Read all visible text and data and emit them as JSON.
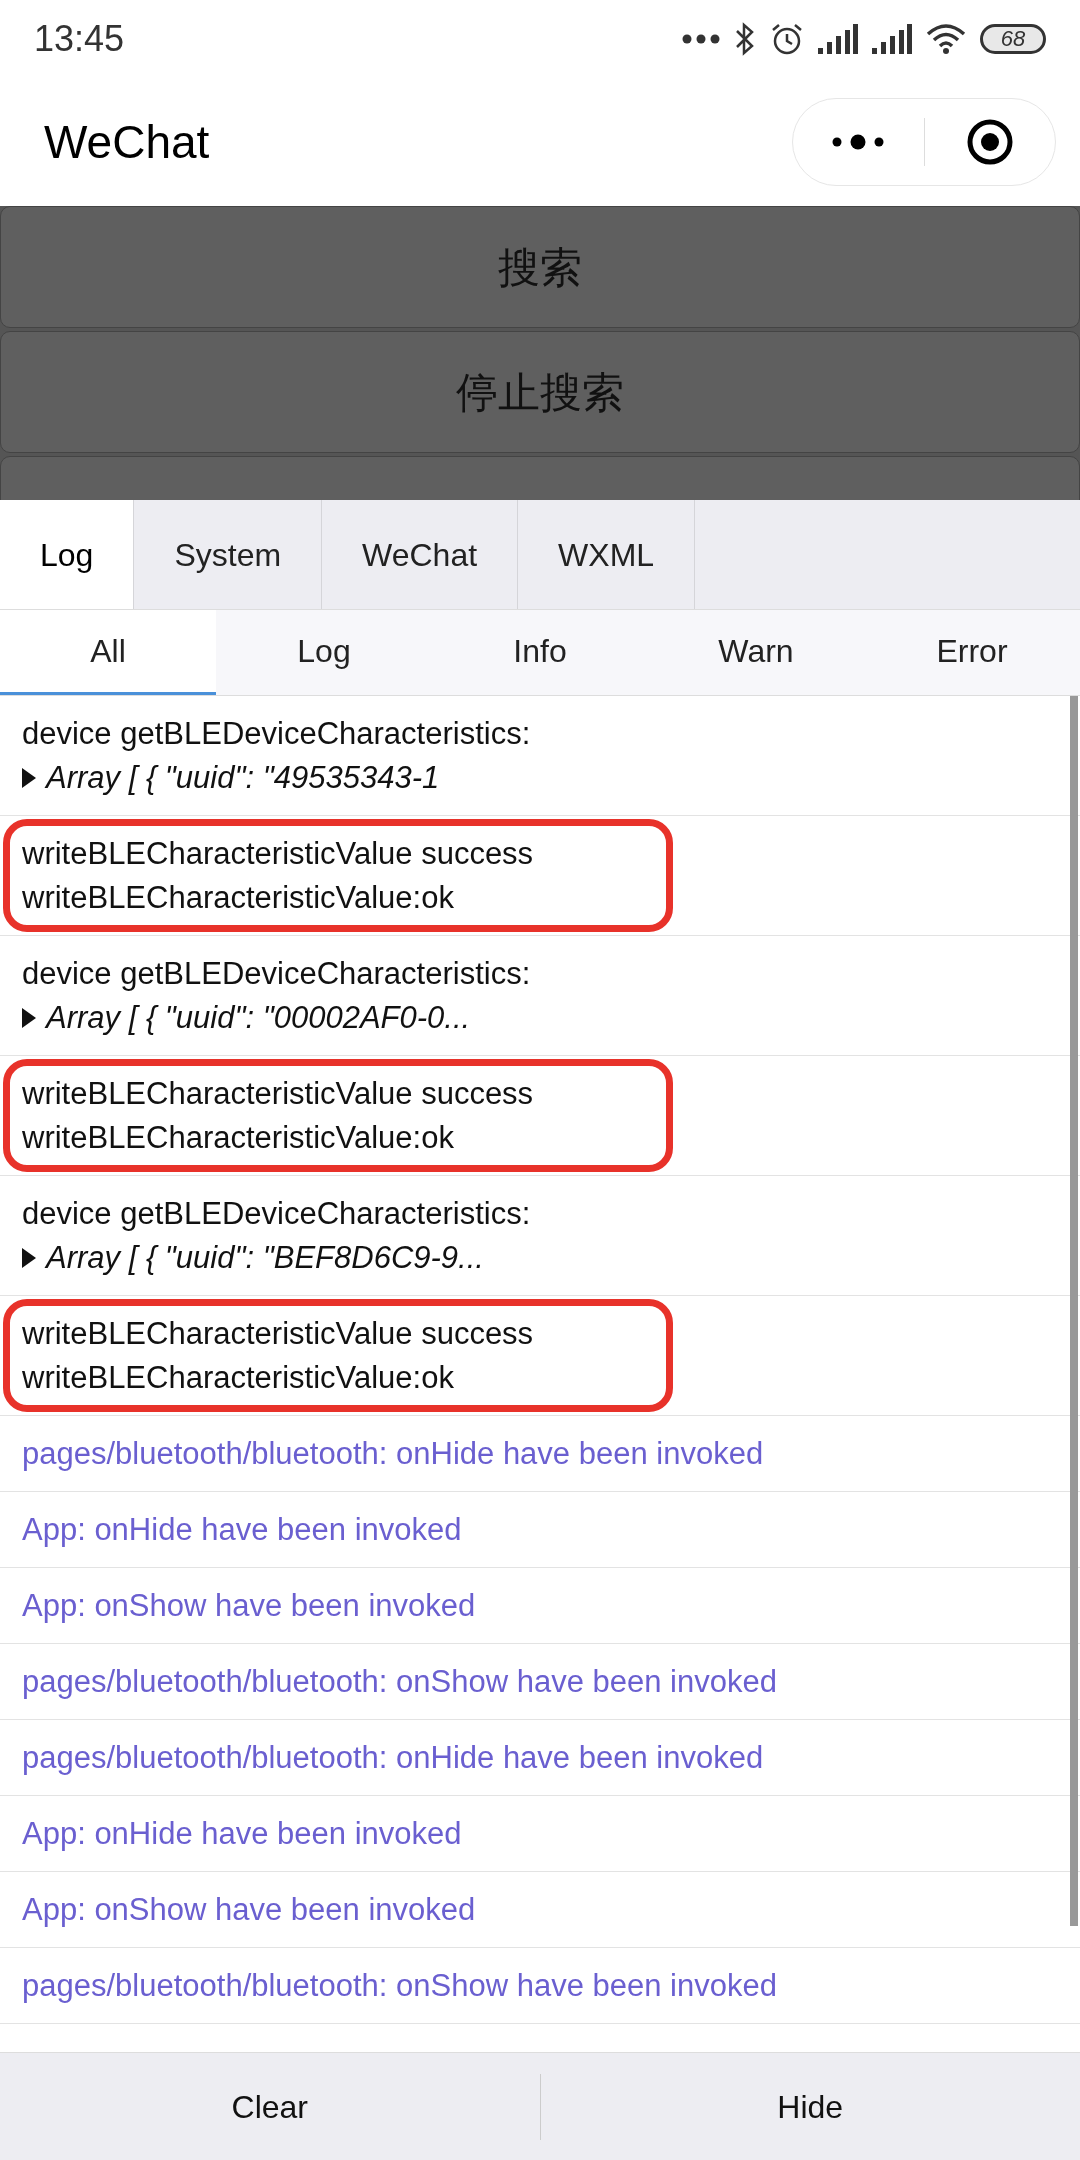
{
  "status_bar": {
    "time": "13:45",
    "battery": "68"
  },
  "title_bar": {
    "title": "WeChat"
  },
  "page_buttons": [
    "搜索",
    "停止搜索"
  ],
  "console": {
    "tabs": [
      {
        "label": "Log",
        "selected": true
      },
      {
        "label": "System",
        "selected": false
      },
      {
        "label": "WeChat",
        "selected": false
      },
      {
        "label": "WXML",
        "selected": false
      }
    ],
    "filters": [
      {
        "label": "All",
        "selected": true
      },
      {
        "label": "Log",
        "selected": false
      },
      {
        "label": "Info",
        "selected": false
      },
      {
        "label": "Warn",
        "selected": false
      },
      {
        "label": "Error",
        "selected": false
      }
    ],
    "entries": [
      {
        "kind": "object",
        "circled": false,
        "title": "device getBLEDeviceCharacteristics:",
        "preview": "Array [ { \"uuid\": \"49535343-1"
      },
      {
        "kind": "text",
        "circled": true,
        "lines": [
          "writeBLECharacteristicValue success",
          "writeBLECharacteristicValue:ok"
        ]
      },
      {
        "kind": "object",
        "circled": false,
        "title": "device getBLEDeviceCharacteristics:",
        "preview": "Array [ { \"uuid\": \"00002AF0-0..."
      },
      {
        "kind": "text",
        "circled": true,
        "lines": [
          "writeBLECharacteristicValue success",
          "writeBLECharacteristicValue:ok"
        ]
      },
      {
        "kind": "object",
        "circled": false,
        "title": "device getBLEDeviceCharacteristics:",
        "preview": "Array [ { \"uuid\": \"BEF8D6C9-9..."
      },
      {
        "kind": "text",
        "circled": true,
        "lines": [
          "writeBLECharacteristicValue success",
          "writeBLECharacteristicValue:ok"
        ]
      },
      {
        "kind": "system",
        "lines": [
          "pages/bluetooth/bluetooth: onHide have been invoked"
        ]
      },
      {
        "kind": "system",
        "lines": [
          "App: onHide have been invoked"
        ]
      },
      {
        "kind": "system",
        "lines": [
          "App: onShow have been invoked"
        ]
      },
      {
        "kind": "system",
        "lines": [
          "pages/bluetooth/bluetooth: onShow have been invoked"
        ]
      },
      {
        "kind": "system",
        "lines": [
          "pages/bluetooth/bluetooth: onHide have been invoked"
        ]
      },
      {
        "kind": "system",
        "lines": [
          "App: onHide have been invoked"
        ]
      },
      {
        "kind": "system",
        "lines": [
          "App: onShow have been invoked"
        ]
      },
      {
        "kind": "system",
        "lines": [
          "pages/bluetooth/bluetooth: onShow have been invoked"
        ]
      }
    ],
    "actions": [
      "Clear",
      "Hide"
    ]
  }
}
